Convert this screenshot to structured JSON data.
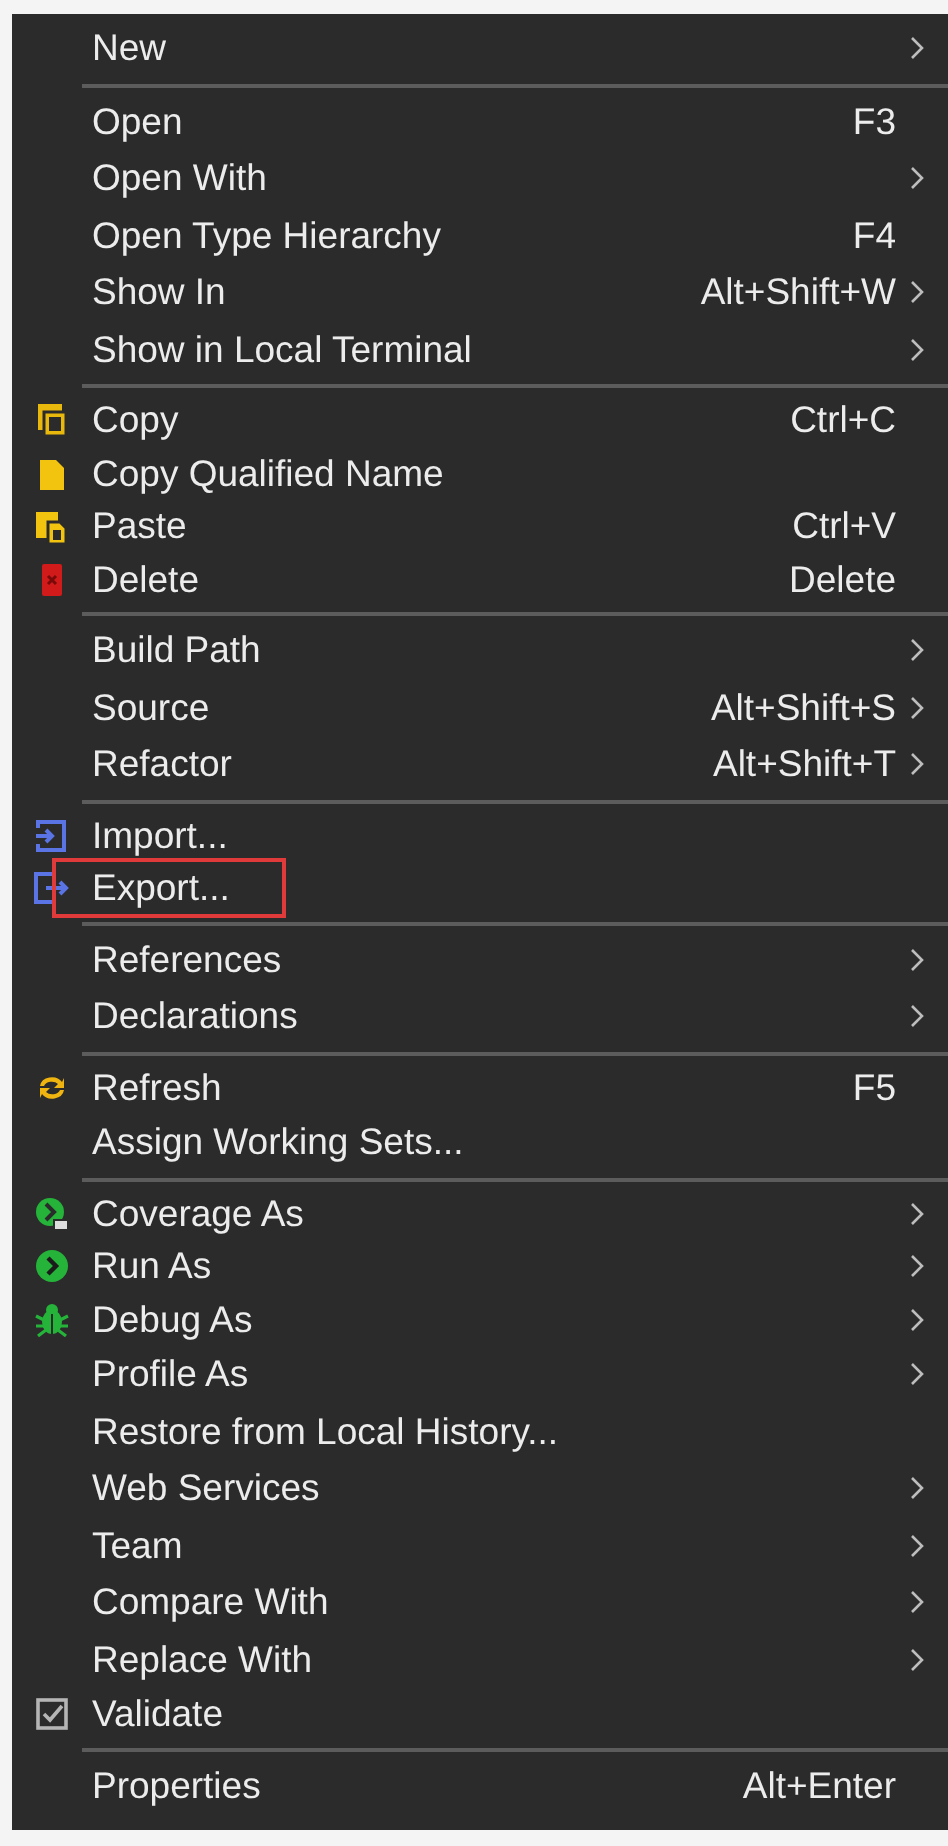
{
  "menu": {
    "sections": [
      {
        "items": [
          {
            "label": "New",
            "submenu": true,
            "highlighted": false
          }
        ]
      },
      {
        "items": [
          {
            "label": "Open",
            "shortcut": "F3",
            "submenu": false,
            "highlighted": false
          },
          {
            "label": "Open With",
            "submenu": true,
            "highlighted": false
          },
          {
            "label": "Open Type Hierarchy",
            "shortcut": "F4",
            "submenu": false,
            "highlighted": false
          },
          {
            "label": "Show In",
            "shortcut": "Alt+Shift+W",
            "submenu": true,
            "highlighted": false
          },
          {
            "label": "Show in Local Terminal",
            "submenu": true,
            "highlighted": false
          }
        ]
      },
      {
        "items": [
          {
            "label": "Copy",
            "shortcut": "Ctrl+C",
            "kind": "copy",
            "submenu": false,
            "highlighted": false
          },
          {
            "label": "Copy Qualified Name",
            "kind": "file",
            "submenu": false,
            "highlighted": false
          },
          {
            "label": "Paste",
            "shortcut": "Ctrl+V",
            "kind": "paste",
            "submenu": false,
            "highlighted": false
          },
          {
            "label": "Delete",
            "shortcut": "Delete",
            "kind": "delete",
            "submenu": false,
            "highlighted": false
          }
        ]
      },
      {
        "items": [
          {
            "label": "Build Path",
            "submenu": true,
            "highlighted": false
          },
          {
            "label": "Source",
            "shortcut": "Alt+Shift+S",
            "submenu": true,
            "highlighted": false
          },
          {
            "label": "Refactor",
            "shortcut": "Alt+Shift+T",
            "submenu": true,
            "highlighted": false
          }
        ]
      },
      {
        "items": [
          {
            "label": "Import...",
            "kind": "import",
            "submenu": false,
            "highlighted": false
          },
          {
            "label": "Export...",
            "kind": "export",
            "submenu": false,
            "highlighted": true
          }
        ]
      },
      {
        "items": [
          {
            "label": "References",
            "submenu": true,
            "highlighted": false
          },
          {
            "label": "Declarations",
            "submenu": true,
            "highlighted": false
          }
        ]
      },
      {
        "items": [
          {
            "label": "Refresh",
            "shortcut": "F5",
            "kind": "refresh",
            "submenu": false,
            "highlighted": false
          },
          {
            "label": "Assign Working Sets...",
            "submenu": false,
            "highlighted": false
          }
        ]
      },
      {
        "items": [
          {
            "label": "Coverage As",
            "kind": "coverage",
            "submenu": true,
            "highlighted": false
          },
          {
            "label": "Run As",
            "kind": "run",
            "submenu": true,
            "highlighted": false
          },
          {
            "label": "Debug As",
            "kind": "debug",
            "submenu": true,
            "highlighted": false
          },
          {
            "label": "Profile As",
            "submenu": true,
            "highlighted": false
          },
          {
            "label": "Restore from Local History...",
            "submenu": false,
            "highlighted": false
          },
          {
            "label": "Web Services",
            "submenu": true,
            "highlighted": false
          },
          {
            "label": "Team",
            "submenu": true,
            "highlighted": false
          },
          {
            "label": "Compare With",
            "submenu": true,
            "highlighted": false
          },
          {
            "label": "Replace With",
            "submenu": true,
            "highlighted": false
          },
          {
            "label": "Validate",
            "kind": "validate",
            "submenu": false,
            "highlighted": false
          }
        ]
      },
      {
        "items": [
          {
            "label": "Properties",
            "shortcut": "Alt+Enter",
            "submenu": false,
            "highlighted": false
          }
        ]
      }
    ]
  }
}
